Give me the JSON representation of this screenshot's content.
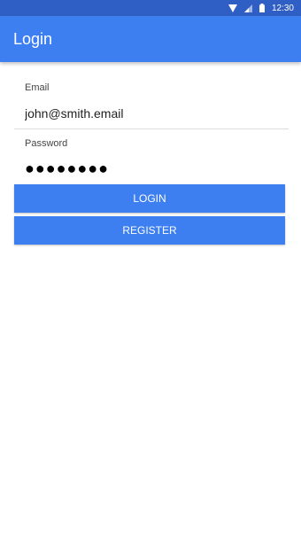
{
  "status_bar": {
    "time": "12:30",
    "icons": [
      "wifi-icon",
      "signal-icon",
      "battery-icon"
    ],
    "color": "#2f5fc4"
  },
  "app_bar": {
    "title": "Login",
    "color": "#3d7ef0"
  },
  "form": {
    "email": {
      "label": "Email",
      "value": "john@smith.email"
    },
    "password": {
      "label": "Password",
      "value": "●●●●●●●●"
    }
  },
  "buttons": {
    "login_label": "LOGIN",
    "register_label": "REGISTER",
    "color": "#3d7ef0"
  }
}
